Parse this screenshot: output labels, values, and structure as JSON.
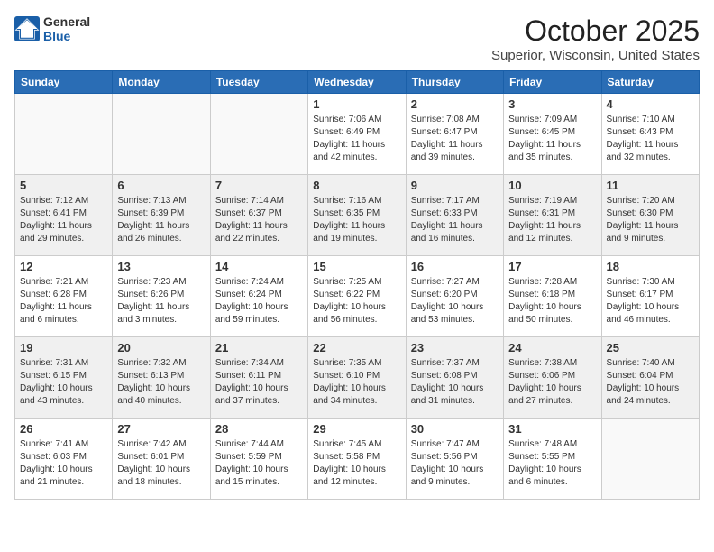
{
  "header": {
    "logo_general": "General",
    "logo_blue": "Blue",
    "month": "October 2025",
    "location": "Superior, Wisconsin, United States"
  },
  "days_of_week": [
    "Sunday",
    "Monday",
    "Tuesday",
    "Wednesday",
    "Thursday",
    "Friday",
    "Saturday"
  ],
  "weeks": [
    [
      {
        "day": "",
        "info": ""
      },
      {
        "day": "",
        "info": ""
      },
      {
        "day": "",
        "info": ""
      },
      {
        "day": "1",
        "info": "Sunrise: 7:06 AM\nSunset: 6:49 PM\nDaylight: 11 hours\nand 42 minutes."
      },
      {
        "day": "2",
        "info": "Sunrise: 7:08 AM\nSunset: 6:47 PM\nDaylight: 11 hours\nand 39 minutes."
      },
      {
        "day": "3",
        "info": "Sunrise: 7:09 AM\nSunset: 6:45 PM\nDaylight: 11 hours\nand 35 minutes."
      },
      {
        "day": "4",
        "info": "Sunrise: 7:10 AM\nSunset: 6:43 PM\nDaylight: 11 hours\nand 32 minutes."
      }
    ],
    [
      {
        "day": "5",
        "info": "Sunrise: 7:12 AM\nSunset: 6:41 PM\nDaylight: 11 hours\nand 29 minutes."
      },
      {
        "day": "6",
        "info": "Sunrise: 7:13 AM\nSunset: 6:39 PM\nDaylight: 11 hours\nand 26 minutes."
      },
      {
        "day": "7",
        "info": "Sunrise: 7:14 AM\nSunset: 6:37 PM\nDaylight: 11 hours\nand 22 minutes."
      },
      {
        "day": "8",
        "info": "Sunrise: 7:16 AM\nSunset: 6:35 PM\nDaylight: 11 hours\nand 19 minutes."
      },
      {
        "day": "9",
        "info": "Sunrise: 7:17 AM\nSunset: 6:33 PM\nDaylight: 11 hours\nand 16 minutes."
      },
      {
        "day": "10",
        "info": "Sunrise: 7:19 AM\nSunset: 6:31 PM\nDaylight: 11 hours\nand 12 minutes."
      },
      {
        "day": "11",
        "info": "Sunrise: 7:20 AM\nSunset: 6:30 PM\nDaylight: 11 hours\nand 9 minutes."
      }
    ],
    [
      {
        "day": "12",
        "info": "Sunrise: 7:21 AM\nSunset: 6:28 PM\nDaylight: 11 hours\nand 6 minutes."
      },
      {
        "day": "13",
        "info": "Sunrise: 7:23 AM\nSunset: 6:26 PM\nDaylight: 11 hours\nand 3 minutes."
      },
      {
        "day": "14",
        "info": "Sunrise: 7:24 AM\nSunset: 6:24 PM\nDaylight: 10 hours\nand 59 minutes."
      },
      {
        "day": "15",
        "info": "Sunrise: 7:25 AM\nSunset: 6:22 PM\nDaylight: 10 hours\nand 56 minutes."
      },
      {
        "day": "16",
        "info": "Sunrise: 7:27 AM\nSunset: 6:20 PM\nDaylight: 10 hours\nand 53 minutes."
      },
      {
        "day": "17",
        "info": "Sunrise: 7:28 AM\nSunset: 6:18 PM\nDaylight: 10 hours\nand 50 minutes."
      },
      {
        "day": "18",
        "info": "Sunrise: 7:30 AM\nSunset: 6:17 PM\nDaylight: 10 hours\nand 46 minutes."
      }
    ],
    [
      {
        "day": "19",
        "info": "Sunrise: 7:31 AM\nSunset: 6:15 PM\nDaylight: 10 hours\nand 43 minutes."
      },
      {
        "day": "20",
        "info": "Sunrise: 7:32 AM\nSunset: 6:13 PM\nDaylight: 10 hours\nand 40 minutes."
      },
      {
        "day": "21",
        "info": "Sunrise: 7:34 AM\nSunset: 6:11 PM\nDaylight: 10 hours\nand 37 minutes."
      },
      {
        "day": "22",
        "info": "Sunrise: 7:35 AM\nSunset: 6:10 PM\nDaylight: 10 hours\nand 34 minutes."
      },
      {
        "day": "23",
        "info": "Sunrise: 7:37 AM\nSunset: 6:08 PM\nDaylight: 10 hours\nand 31 minutes."
      },
      {
        "day": "24",
        "info": "Sunrise: 7:38 AM\nSunset: 6:06 PM\nDaylight: 10 hours\nand 27 minutes."
      },
      {
        "day": "25",
        "info": "Sunrise: 7:40 AM\nSunset: 6:04 PM\nDaylight: 10 hours\nand 24 minutes."
      }
    ],
    [
      {
        "day": "26",
        "info": "Sunrise: 7:41 AM\nSunset: 6:03 PM\nDaylight: 10 hours\nand 21 minutes."
      },
      {
        "day": "27",
        "info": "Sunrise: 7:42 AM\nSunset: 6:01 PM\nDaylight: 10 hours\nand 18 minutes."
      },
      {
        "day": "28",
        "info": "Sunrise: 7:44 AM\nSunset: 5:59 PM\nDaylight: 10 hours\nand 15 minutes."
      },
      {
        "day": "29",
        "info": "Sunrise: 7:45 AM\nSunset: 5:58 PM\nDaylight: 10 hours\nand 12 minutes."
      },
      {
        "day": "30",
        "info": "Sunrise: 7:47 AM\nSunset: 5:56 PM\nDaylight: 10 hours\nand 9 minutes."
      },
      {
        "day": "31",
        "info": "Sunrise: 7:48 AM\nSunset: 5:55 PM\nDaylight: 10 hours\nand 6 minutes."
      },
      {
        "day": "",
        "info": ""
      }
    ]
  ],
  "shaded_rows": [
    1,
    3
  ]
}
